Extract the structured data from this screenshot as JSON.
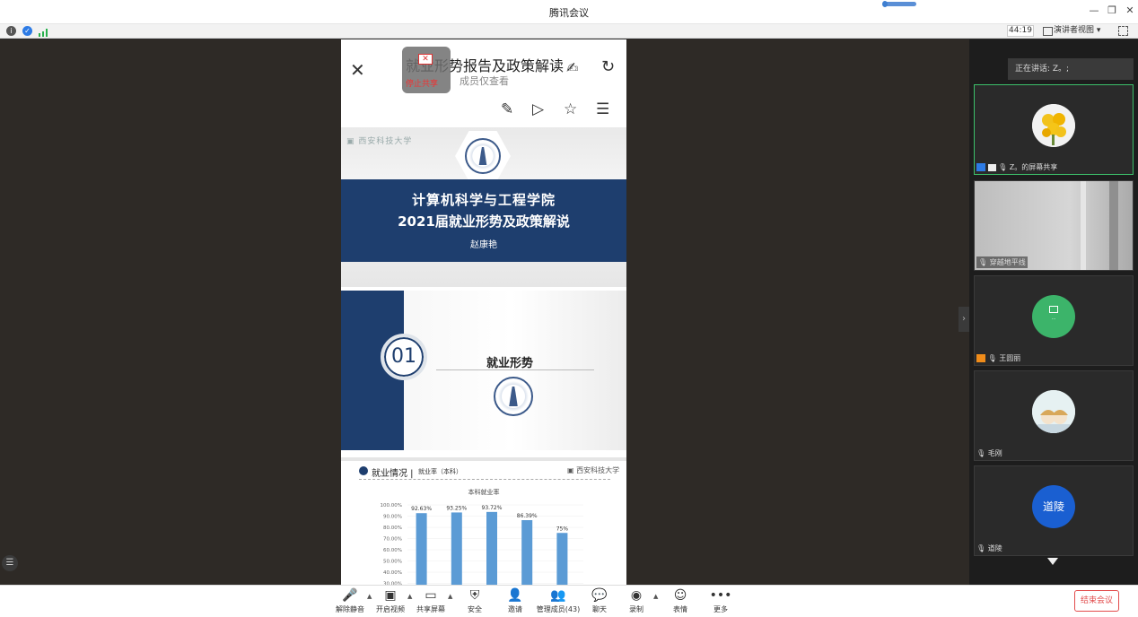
{
  "window": {
    "title": "腾讯会议"
  },
  "status": {
    "timer": "44:19",
    "view_label": "演讲者视图"
  },
  "doc": {
    "title": "就业形势报告及政策解读",
    "subtitle": "成员仅查看",
    "overlay_text": "停止共享"
  },
  "slide1": {
    "line1": "计算机科学与工程学院",
    "line2": "2021届就业形势及政策解说",
    "author": "赵康艳"
  },
  "slide2": {
    "number": "01",
    "section": "就业形势"
  },
  "slide3": {
    "title": "就业情况 |",
    "subtitle": "就业率（本科）"
  },
  "chart_data": {
    "type": "bar",
    "title": "本科就业率",
    "categories": [
      "",
      "",
      "",
      "",
      ""
    ],
    "values": [
      92.63,
      93.25,
      93.72,
      86.39,
      75
    ],
    "value_labels": [
      "92.63%",
      "93.25%",
      "93.72%",
      "86.39%",
      "75%"
    ],
    "y_ticks": [
      "100.00%",
      "90.00%",
      "80.00%",
      "70.00%",
      "60.00%",
      "50.00%",
      "40.00%",
      "30.00%"
    ],
    "ylim": [
      30,
      100
    ],
    "color": "#5b9bd5"
  },
  "sidebar": {
    "speaking": "正在讲话: Z。;",
    "tiles": [
      {
        "caption": "Z。的屏幕共享"
      },
      {
        "caption": "穿越地平线"
      },
      {
        "caption": "王圆丽"
      },
      {
        "caption": "毛刚"
      },
      {
        "caption": "道陵",
        "avatar_text": "道陵"
      }
    ]
  },
  "toolbar": {
    "unmute": "解除静音",
    "video": "开启视频",
    "share": "共享屏幕",
    "security": "安全",
    "invite": "邀请",
    "members": "管理成员(43)",
    "chat": "聊天",
    "record": "录制",
    "emoji": "表情",
    "more": "更多",
    "end": "结束会议"
  }
}
